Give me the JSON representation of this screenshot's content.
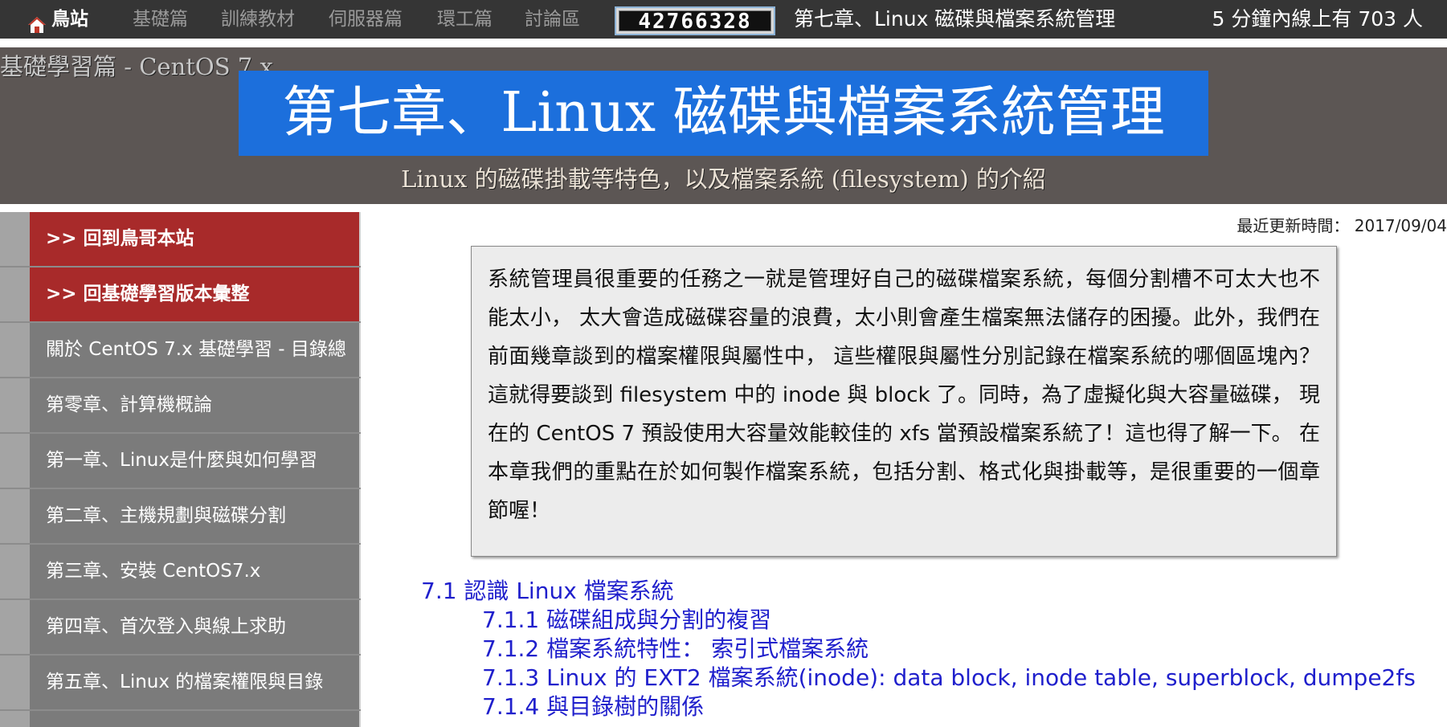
{
  "topnav": {
    "home_label": "鳥站",
    "home_icon": "home-icon",
    "items": [
      "基礎篇",
      "訓練教材",
      "伺服器篇",
      "環工篇",
      "討論區"
    ],
    "counter_value": "42766328",
    "chapter_title": "第七章、Linux 磁碟與檔案系統管理",
    "online_text": "5 分鐘內線上有 703 人"
  },
  "banner": {
    "series": "基礎學習篇 - CentOS 7.x",
    "title": "第七章、Linux 磁碟與檔案系統管理",
    "subtitle": "Linux 的磁碟掛載等特色，以及檔案系統 (filesystem) 的介紹"
  },
  "sidebar": {
    "items": [
      {
        "label": ">> 回到鳥哥本站"
      },
      {
        "label": ">> 回基礎學習版本彙整"
      },
      {
        "label": "關於 CentOS 7.x 基礎學習 - 目錄總"
      },
      {
        "label": "第零章、計算機概論"
      },
      {
        "label": "第一章、Linux是什麼與如何學習"
      },
      {
        "label": "第二章、主機規劃與磁碟分割"
      },
      {
        "label": "第三章、安裝 CentOS7.x"
      },
      {
        "label": "第四章、首次登入與線上求助"
      },
      {
        "label": "第五章、Linux 的檔案權限與目錄"
      }
    ]
  },
  "main": {
    "updated": "最近更新時間： 2017/09/04",
    "abstract": "系統管理員很重要的任務之一就是管理好自己的磁碟檔案系統，每個分割槽不可太大也不能太小， 太大會造成磁碟容量的浪費，太小則會產生檔案無法儲存的困擾。此外，我們在前面幾章談到的檔案權限與屬性中， 這些權限與屬性分別記錄在檔案系統的哪個區塊內？這就得要談到 filesystem 中的 inode 與 block 了。同時，為了虛擬化與大容量磁碟， 現在的 CentOS 7 預設使用大容量效能較佳的 xfs 當預設檔案系統了！這也得了解一下。 在本章我們的重點在於如何製作檔案系統，包括分割、格式化與掛載等，是很重要的一個章節喔！",
    "toc": {
      "s71": "7.1 認識 Linux 檔案系統",
      "s711": "7.1.1 磁碟組成與分割的複習",
      "s712": "7.1.2 檔案系統特性：",
      "s712b": "索引式檔案系統",
      "s713": "7.1.3 Linux 的 EXT2 檔案系統(inode):",
      "s713_links": [
        "data block",
        "inode table",
        "superblock",
        "dumpe2fs"
      ],
      "s714": "7.1.4 與目錄樹的關係"
    }
  }
}
